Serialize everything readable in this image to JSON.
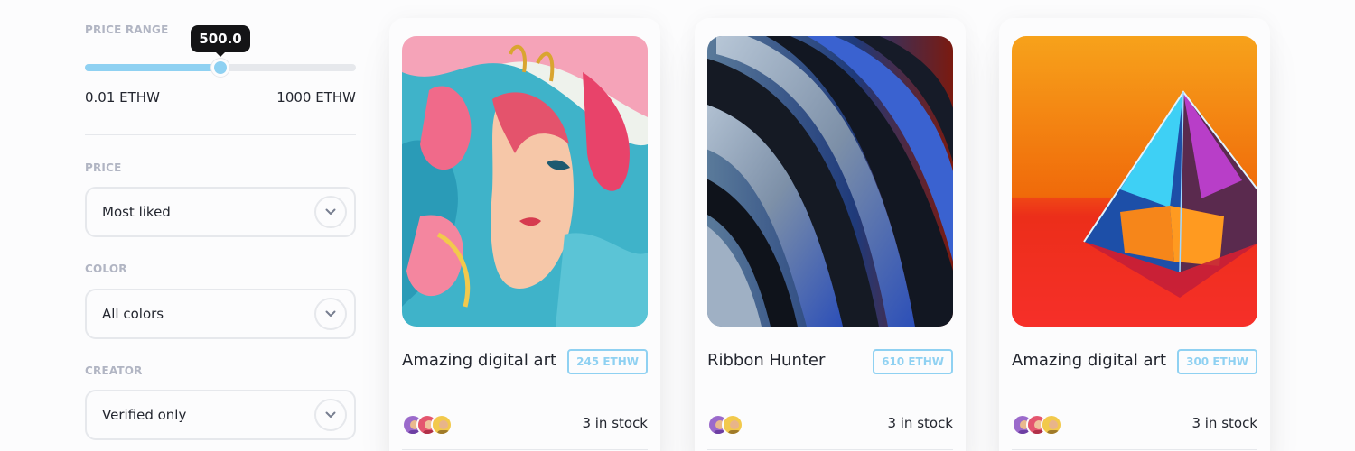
{
  "filters": {
    "price_range": {
      "label": "PRICE RANGE",
      "tooltip": "500.0",
      "min_label": "0.01 ETHW",
      "max_label": "1000 ETHW",
      "value_fraction": 0.5
    },
    "price": {
      "label": "PRICE",
      "selected": "Most liked"
    },
    "color": {
      "label": "COLOR",
      "selected": "All colors"
    },
    "creator": {
      "label": "CREATOR",
      "selected": "Verified only"
    }
  },
  "cards": [
    {
      "title": "Amazing digital art",
      "price": "245 ETHW",
      "stock": "3 in stock",
      "image": "watercolor-portrait"
    },
    {
      "title": "Ribbon Hunter",
      "price": "610 ETHW",
      "stock": "3 in stock",
      "image": "metal-ribbons"
    },
    {
      "title": "Amazing digital art",
      "price": "300 ETHW",
      "stock": "3 in stock",
      "image": "prism-pyramid"
    }
  ],
  "colors": {
    "accent": "#8fd1f2",
    "tooltip_bg": "#141416",
    "label": "#b1b5c3",
    "border": "#e6e8ec"
  }
}
